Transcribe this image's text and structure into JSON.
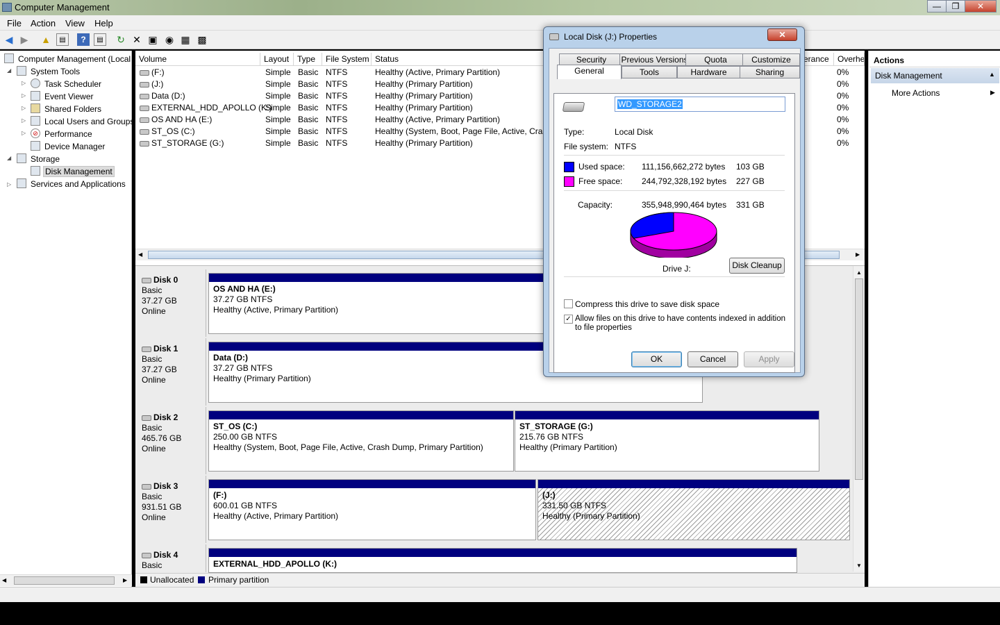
{
  "window": {
    "title": "Computer Management",
    "minimize": "—",
    "maximize": "❒",
    "close": "✕"
  },
  "menu": [
    "File",
    "Action",
    "View",
    "Help"
  ],
  "toolbar_icons": [
    "back-icon",
    "forward-icon",
    "up-folder-icon",
    "show-hide-tree-icon",
    "help-icon",
    "properties-icon",
    "refresh-icon",
    "delete-icon",
    "connect-icon",
    "search-icon",
    "export-icon"
  ],
  "tree": {
    "root": "Computer Management (Local",
    "system_tools": "System Tools",
    "task_scheduler": "Task Scheduler",
    "event_viewer": "Event Viewer",
    "shared_folders": "Shared Folders",
    "local_users": "Local Users and Groups",
    "performance": "Performance",
    "device_manager": "Device Manager",
    "storage": "Storage",
    "disk_management": "Disk Management",
    "services": "Services and Applications"
  },
  "volume_table": {
    "headers": [
      "Volume",
      "Layout",
      "Type",
      "File System",
      "Status",
      "erance",
      "Overhe"
    ],
    "rows": [
      [
        "(F:)",
        "Simple",
        "Basic",
        "NTFS",
        "Healthy (Active, Primary Partition)",
        "0%"
      ],
      [
        "(J:)",
        "Simple",
        "Basic",
        "NTFS",
        "Healthy (Primary Partition)",
        "0%"
      ],
      [
        "Data (D:)",
        "Simple",
        "Basic",
        "NTFS",
        "Healthy (Primary Partition)",
        "0%"
      ],
      [
        "EXTERNAL_HDD_APOLLO (K:)",
        "Simple",
        "Basic",
        "NTFS",
        "Healthy (Primary Partition)",
        "0%"
      ],
      [
        "OS AND HA (E:)",
        "Simple",
        "Basic",
        "NTFS",
        "Healthy (Active, Primary Partition)",
        "0%"
      ],
      [
        "ST_OS (C:)",
        "Simple",
        "Basic",
        "NTFS",
        "Healthy (System, Boot, Page File, Active, Crash",
        "0%"
      ],
      [
        "ST_STORAGE (G:)",
        "Simple",
        "Basic",
        "NTFS",
        "Healthy (Primary Partition)",
        "0%"
      ]
    ]
  },
  "disks": [
    {
      "name": "Disk 0",
      "type": "Basic",
      "size": "37.27 GB",
      "state": "Online",
      "parts": [
        {
          "name": "OS AND HA  (E:)",
          "size": "37.27 GB NTFS",
          "status": "Healthy (Active, Primary Partition)"
        }
      ]
    },
    {
      "name": "Disk 1",
      "type": "Basic",
      "size": "37.27 GB",
      "state": "Online",
      "parts": [
        {
          "name": "Data  (D:)",
          "size": "37.27 GB NTFS",
          "status": "Healthy (Primary Partition)"
        }
      ]
    },
    {
      "name": "Disk 2",
      "type": "Basic",
      "size": "465.76 GB",
      "state": "Online",
      "parts": [
        {
          "name": "ST_OS  (C:)",
          "size": "250.00 GB NTFS",
          "status": "Healthy (System, Boot, Page File, Active, Crash Dump, Primary Partition)"
        },
        {
          "name": "ST_STORAGE  (G:)",
          "size": "215.76 GB NTFS",
          "status": "Healthy (Primary Partition)"
        }
      ]
    },
    {
      "name": "Disk 3",
      "type": "Basic",
      "size": "931.51 GB",
      "state": "Online",
      "parts": [
        {
          "name": "(F:)",
          "size": "600.01 GB NTFS",
          "status": "Healthy (Active, Primary Partition)"
        },
        {
          "name": "(J:)",
          "size": "331.50 GB NTFS",
          "status": "Healthy (Primary Partition)"
        }
      ]
    },
    {
      "name": "Disk 4",
      "type": "Basic",
      "parts": [
        {
          "name": "EXTERNAL_HDD_APOLLO  (K:)"
        }
      ]
    }
  ],
  "legend": {
    "unallocated": "Unallocated",
    "primary": "Primary partition"
  },
  "actions": {
    "header": "Actions",
    "section": "Disk Management",
    "more": "More Actions"
  },
  "dialog": {
    "title": "Local Disk (J:) Properties",
    "close": "✕",
    "tabs_row1": [
      "Security",
      "Previous Versions",
      "Quota",
      "Customize"
    ],
    "tabs_row2": [
      "General",
      "Tools",
      "Hardware",
      "Sharing"
    ],
    "label_value": "WD_STORAGE2",
    "type_label": "Type:",
    "type_value": "Local Disk",
    "fs_label": "File system:",
    "fs_value": "NTFS",
    "used_label": "Used space:",
    "used_bytes": "111,156,662,272 bytes",
    "used_gb": "103 GB",
    "free_label": "Free space:",
    "free_bytes": "244,792,328,192 bytes",
    "free_gb": "227 GB",
    "cap_label": "Capacity:",
    "cap_bytes": "355,948,990,464 bytes",
    "cap_gb": "331 GB",
    "drive_caption": "Drive J:",
    "cleanup": "Disk Cleanup",
    "compress": "Compress this drive to save disk space",
    "index": "Allow files on this drive to have contents indexed in addition to file properties",
    "ok": "OK",
    "cancel": "Cancel",
    "apply": "Apply",
    "used_fraction": 0.312,
    "used_color": "#0000ff",
    "free_color": "#ff00ff"
  }
}
